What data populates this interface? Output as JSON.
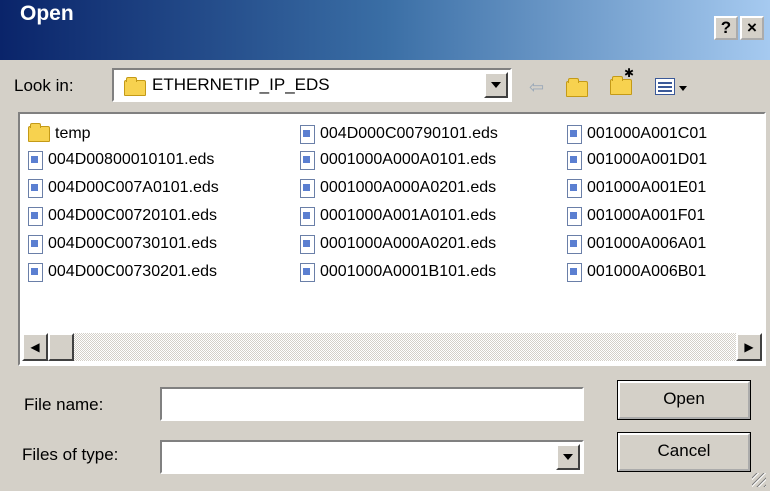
{
  "window": {
    "title": "Open"
  },
  "title_buttons": {
    "help": "?",
    "close": "×"
  },
  "look_in": {
    "label": "Look in:",
    "folder": "ETHERNETIP_IP_EDS"
  },
  "toolbar_icons": [
    "back-arrow-icon",
    "up-folder-icon",
    "new-folder-icon",
    "view-menu-icon"
  ],
  "files": [
    [
      "temp",
      "004D00800010101.eds",
      "004D00C007A0101.eds",
      "004D00C00720101.eds",
      "004D00C00730101.eds",
      "004D00C00730201.eds"
    ],
    [
      "004D000C00790101.eds",
      "0001000A000A0101.eds",
      "0001000A000A0201.eds",
      "0001000A001A0101.eds",
      "0001000A000A0201.eds",
      "0001000A0001B101.eds"
    ],
    [
      "001000A001C01",
      "001000A001D01",
      "001000A001E01",
      "001000A001F01",
      "001000A006A01",
      "001000A006B01"
    ]
  ],
  "file_name": {
    "label": "File name:",
    "value": ""
  },
  "file_type": {
    "label": "Files of type:",
    "value": ""
  },
  "buttons": {
    "open": "Open",
    "cancel": "Cancel"
  }
}
